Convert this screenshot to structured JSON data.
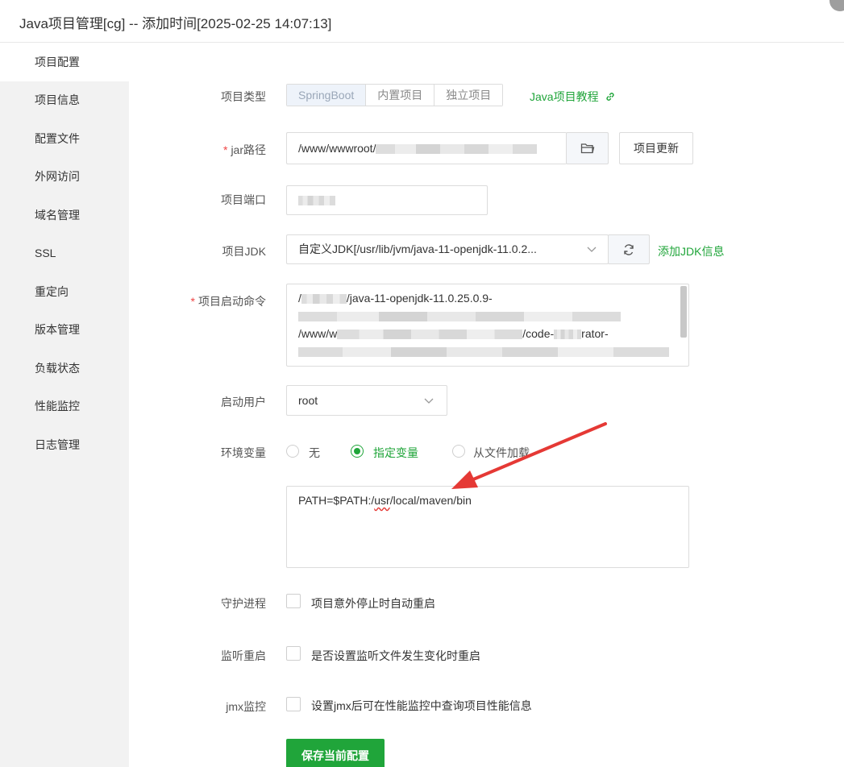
{
  "window": {
    "title": "Java项目管理[cg] -- 添加时间[2025-02-25 14:07:13]"
  },
  "sidebar": {
    "items": [
      {
        "label": "项目配置",
        "active": true
      },
      {
        "label": "项目信息"
      },
      {
        "label": "配置文件"
      },
      {
        "label": "外网访问"
      },
      {
        "label": "域名管理"
      },
      {
        "label": "SSL"
      },
      {
        "label": "重定向"
      },
      {
        "label": "版本管理"
      },
      {
        "label": "负载状态"
      },
      {
        "label": "性能监控"
      },
      {
        "label": "日志管理"
      }
    ]
  },
  "form": {
    "project_type": {
      "label": "项目类型",
      "options": [
        "SpringBoot",
        "内置项目",
        "独立项目"
      ],
      "selected": "SpringBoot",
      "tutorial_link": "Java项目教程"
    },
    "jar_path": {
      "required_mark": "*",
      "label": "jar路径",
      "value_visible": "/www/wwwroot/",
      "update_button": "项目更新"
    },
    "port": {
      "label": "项目端口"
    },
    "jdk": {
      "label": "项目JDK",
      "value": "自定义JDK[/usr/lib/jvm/java-11-openjdk-11.0.2...",
      "add_link": "添加JDK信息"
    },
    "start_command": {
      "required_mark": "*",
      "label": "项目启动命令",
      "line1": "/",
      "line1b": "/java-11-openjdk-11.0.25.0.9-",
      "line3a": "/www/w",
      "line3b": "/code-",
      "line3c": "rator-"
    },
    "run_user": {
      "label": "启动用户",
      "value": "root"
    },
    "env": {
      "label": "环境变量",
      "options": [
        "无",
        "指定变量",
        "从文件加载"
      ],
      "selected": "指定变量",
      "value_prefix": "PATH=$PATH:/",
      "value_usr": "usr",
      "value_suffix": "/local/maven/bin"
    },
    "daemon": {
      "label": "守护进程",
      "checkbox_label": "项目意外停止时自动重启"
    },
    "watch_restart": {
      "label": "监听重启",
      "checkbox_label": "是否设置监听文件发生变化时重启"
    },
    "jmx": {
      "label": "jmx监控",
      "checkbox_label": "设置jmx后可在性能监控中查询项目性能信息"
    },
    "save_button": "保存当前配置"
  },
  "colors": {
    "accent_green": "#20a53a",
    "required_red": "#ef4444",
    "annotation_arrow": "#e53935"
  }
}
